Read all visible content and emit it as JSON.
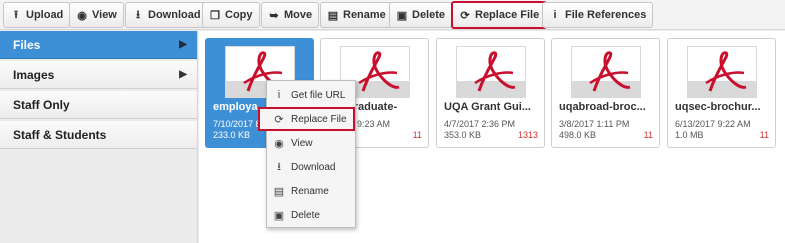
{
  "toolbar": {
    "buttons": [
      {
        "label": "Upload",
        "icon": "upload-icon"
      },
      {
        "label": "View",
        "icon": "eye-icon"
      },
      {
        "label": "Download",
        "icon": "download-icon"
      },
      {
        "label": "Copy",
        "icon": "copy-icon"
      },
      {
        "label": "Move",
        "icon": "move-icon"
      },
      {
        "label": "Rename",
        "icon": "rename-icon"
      },
      {
        "label": "Delete",
        "icon": "delete-icon"
      },
      {
        "label": "Replace File",
        "icon": "refresh-icon"
      },
      {
        "label": "File References",
        "icon": "info-icon"
      }
    ]
  },
  "sidebar": {
    "items": [
      {
        "label": "Files",
        "active": true
      },
      {
        "label": "Images"
      },
      {
        "label": "Staff Only"
      },
      {
        "label": "Staff & Students"
      }
    ]
  },
  "files": [
    {
      "name": "employa",
      "date": "7/10/2017 8:",
      "size": "233.0 KB",
      "count": "",
      "selected": true
    },
    {
      "name": "graduate-",
      "date": "9:23 AM",
      "size": "",
      "count": "11"
    },
    {
      "name": "UQA Grant Gui...",
      "date": "4/7/2017 2:36 PM",
      "size": "353.0 KB",
      "count": "1313"
    },
    {
      "name": "uqabroad-broc...",
      "date": "3/8/2017 1:11 PM",
      "size": "498.0 KB",
      "count": "11"
    },
    {
      "name": "uqsec-brochur...",
      "date": "6/13/2017 9:22 AM",
      "size": "1.0 MB",
      "count": "11"
    }
  ],
  "context_menu": {
    "items": [
      {
        "label": "Get file URL",
        "icon": "info-icon"
      },
      {
        "label": "Replace File",
        "icon": "refresh-icon",
        "highlight": true
      },
      {
        "label": "View",
        "icon": "eye-icon"
      },
      {
        "label": "Download",
        "icon": "download-icon"
      },
      {
        "label": "Rename",
        "icon": "rename-icon"
      },
      {
        "label": "Delete",
        "icon": "delete-icon"
      }
    ]
  },
  "colors": {
    "accent": "#3d8fd6",
    "highlight": "#c8102e",
    "count": "#d0312d",
    "pdf_ribbon": "#c8102e"
  }
}
